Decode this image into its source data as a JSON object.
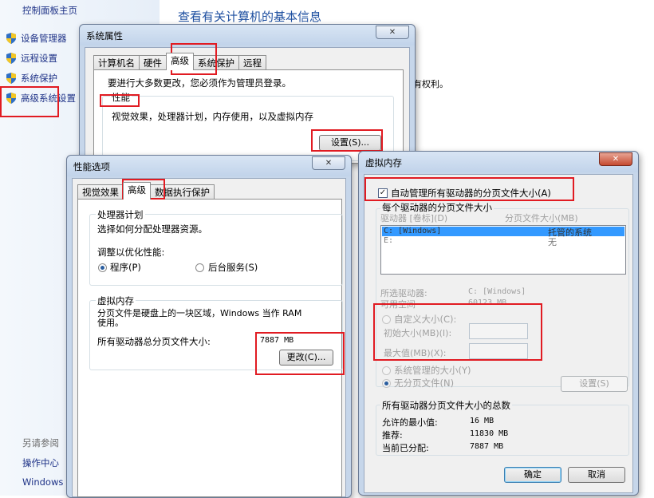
{
  "control_panel": {
    "home": "控制面板主页",
    "heading": "查看有关计算机的基本信息",
    "side_links": [
      "设备管理器",
      "远程设置",
      "系统保护",
      "高级系统设置"
    ],
    "side_fragment": "有权利。",
    "see_also_title": "另请参阅",
    "see_also_items": [
      "操作中心",
      "Windows"
    ]
  },
  "system_props": {
    "title": "系统属性",
    "close_glyph": "✕",
    "tabs": [
      "计算机名",
      "硬件",
      "高级",
      "系统保护",
      "远程"
    ],
    "admin_note": "要进行大多数更改，您必须作为管理员登录。",
    "perf_title": "性能",
    "perf_desc": "视觉效果，处理器计划，内存使用，以及虚拟内存",
    "settings_button": "设置(S)..."
  },
  "perf_options": {
    "title": "性能选项",
    "close_glyph": "✕",
    "tabs": [
      "视觉效果",
      "高级",
      "数据执行保护"
    ],
    "cpu_group": "处理器计划",
    "cpu_desc": "选择如何分配处理器资源。",
    "optimize_label": "调整以优化性能:",
    "radio_programs": "程序(P)",
    "radio_services": "后台服务(S)",
    "vm_group": "虚拟内存",
    "vm_desc": "分页文件是硬盘上的一块区域，Windows 当作 RAM 使用。",
    "total_label": "所有驱动器总分页文件大小:",
    "total_value": "7887 MB",
    "change_button": "更改(C)..."
  },
  "virtual_memory": {
    "title": "虚拟内存",
    "close_glyph": "✕",
    "auto_manage": "自动管理所有驱动器的分页文件大小(A)",
    "auto_checked": "✓",
    "per_drive_group": "每个驱动器的分页文件大小",
    "col_drive": "驱动器 [卷标](D)",
    "col_size": "分页文件大小(MB)",
    "drives": [
      {
        "drive": "C:   [Windows]",
        "size": "托管的系统"
      },
      {
        "drive": "E:",
        "size": "无"
      }
    ],
    "selected_drive_label": "所选驱动器:",
    "selected_drive_value": "C:  [Windows]",
    "free_space_label": "可用空间",
    "free_space_value": "60123 MB",
    "custom_size": "自定义大小(C):",
    "initial_size": "初始大小(MB)(I):",
    "max_size": "最大值(MB)(X):",
    "system_managed": "系统管理的大小(Y)",
    "no_paging": "无分页文件(N)",
    "set_button": "设置(S)",
    "total_group": "所有驱动器分页文件大小的总数",
    "min_allowed_label": "允许的最小值:",
    "min_allowed_value": "16 MB",
    "recommended_label": "推荐:",
    "recommended_value": "11830 MB",
    "allocated_label": "当前已分配:",
    "allocated_value": "7887 MB",
    "ok_button": "确定",
    "cancel_button": "取消"
  },
  "colors": {
    "highlight": "#e11b22",
    "link": "#1e3287",
    "heading": "#1e4fa0",
    "selection": "#3399ff"
  }
}
